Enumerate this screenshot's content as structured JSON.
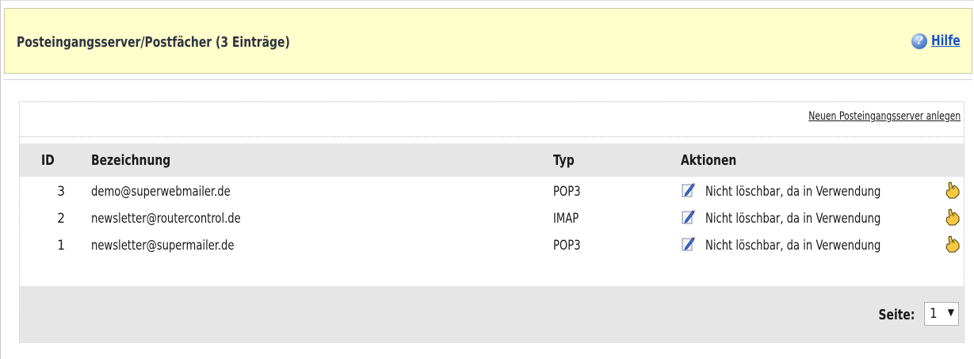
{
  "header": {
    "title": "Posteingangsserver/Postfächer (3 Einträge)",
    "help_label": "Hilfe",
    "help_icon_glyph": "?"
  },
  "panel": {
    "new_server_link": "Neuen Posteingangsserver anlegen",
    "columns": {
      "id": "ID",
      "name": "Bezeichnung",
      "type": "Typ",
      "actions": "Aktionen"
    },
    "rows": [
      {
        "id": "3",
        "name": "demo@superwebmailer.de",
        "type": "POP3",
        "action_text": "Nicht löschbar, da in Verwendung"
      },
      {
        "id": "2",
        "name": "newsletter@routercontrol.de",
        "type": "IMAP",
        "action_text": "Nicht löschbar, da in Verwendung"
      },
      {
        "id": "1",
        "name": "newsletter@supermailer.de",
        "type": "POP3",
        "action_text": "Nicht löschbar, da in Verwendung"
      }
    ],
    "pagination": {
      "label": "Seite:",
      "current_page": "1"
    }
  },
  "icons": {
    "help": "help-icon",
    "edit": "edit-pencil-icon",
    "hand": "hand-pointer-icon",
    "dropdown": "chevron-down-icon"
  },
  "colors": {
    "header_bg": "#ffffcc",
    "link_blue": "#1a55c8",
    "table_header_bg": "#e6e6e6"
  }
}
